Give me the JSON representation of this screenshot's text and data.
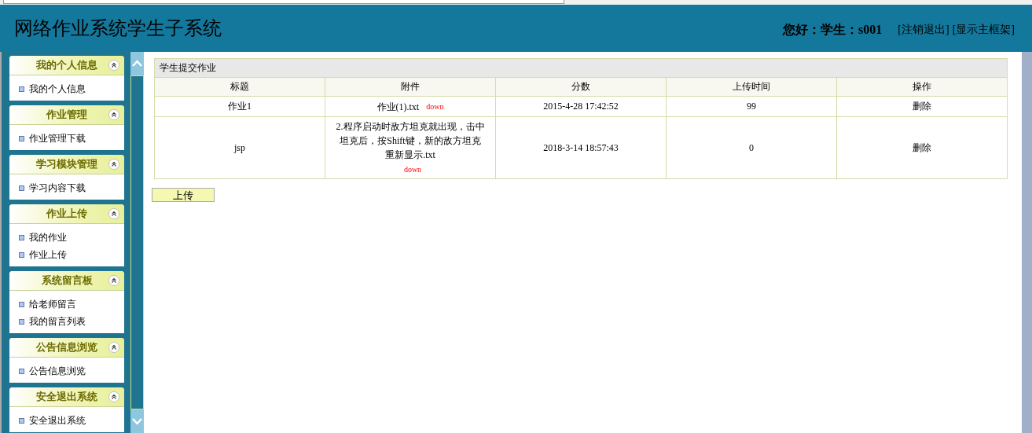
{
  "header": {
    "title": "网络作业系统学生子系统",
    "greeting": "您好：学生：s001",
    "links": [
      "[注销退出]",
      "[显示主框架]"
    ]
  },
  "sidebar": [
    {
      "title": "我的个人信息",
      "expanded": true,
      "items": [
        "我的个人信息"
      ]
    },
    {
      "title": "作业管理",
      "expanded": true,
      "items": [
        "作业管理下载"
      ]
    },
    {
      "title": "学习模块管理",
      "expanded": true,
      "items": [
        "学习内容下载"
      ]
    },
    {
      "title": "作业上传",
      "expanded": true,
      "items": [
        "我的作业",
        "作业上传"
      ]
    },
    {
      "title": "系统留言板",
      "expanded": true,
      "items": [
        "给老师留言",
        "我的留言列表"
      ]
    },
    {
      "title": "公告信息浏览",
      "expanded": true,
      "items": [
        "公告信息浏览"
      ]
    },
    {
      "title": "安全退出系统",
      "expanded": true,
      "items": [
        "安全退出系统"
      ]
    }
  ],
  "table": {
    "caption": "学生提交作业",
    "columns": [
      "标题",
      "附件",
      "分数",
      "上传时间",
      "操作"
    ],
    "rows": [
      {
        "title": "作业1",
        "attachment": "作业(1).txt",
        "download": "down",
        "column_3": "2015-4-28 17:42:52",
        "column_4": "99",
        "action": "删除"
      },
      {
        "title": "jsp",
        "attachment": "2.程序启动时敌方坦克就出现，击中坦克后，按Shift键，新的敌方坦克重新显示.txt",
        "download": "down",
        "column_3": "2018-3-14 18:57:43",
        "column_4": "0",
        "action": "删除"
      }
    ]
  },
  "upload_button": "上传"
}
